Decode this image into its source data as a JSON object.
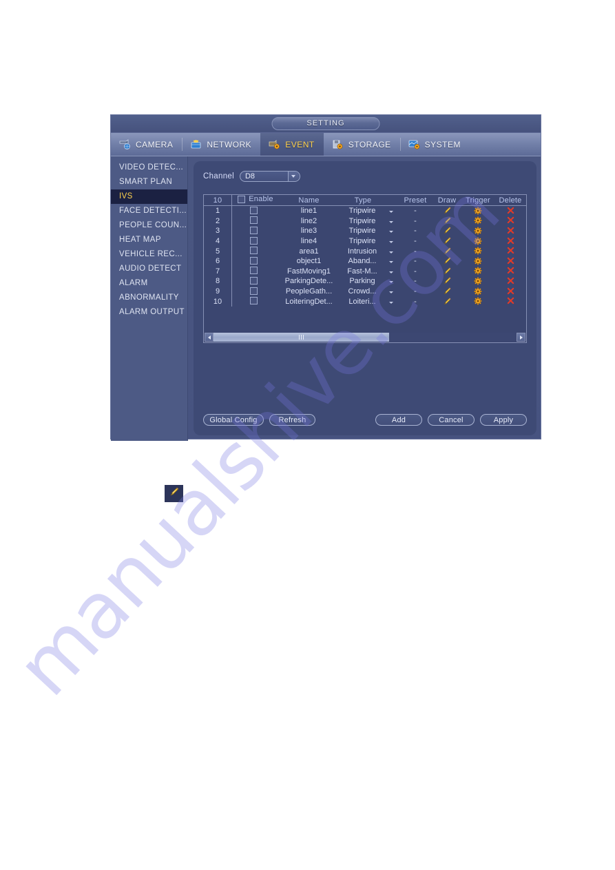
{
  "window": {
    "title": "SETTING"
  },
  "tabs": [
    {
      "label": "CAMERA",
      "icon": "camera-icon",
      "active": false
    },
    {
      "label": "NETWORK",
      "icon": "network-icon",
      "active": false
    },
    {
      "label": "EVENT",
      "icon": "event-icon",
      "active": true
    },
    {
      "label": "STORAGE",
      "icon": "storage-icon",
      "active": false
    },
    {
      "label": "SYSTEM",
      "icon": "system-icon",
      "active": false
    }
  ],
  "sidebar": {
    "items": [
      {
        "label": "VIDEO DETEC...",
        "active": false
      },
      {
        "label": "SMART PLAN",
        "active": false
      },
      {
        "label": "IVS",
        "active": true
      },
      {
        "label": "FACE DETECTI...",
        "active": false
      },
      {
        "label": "PEOPLE COUN...",
        "active": false
      },
      {
        "label": "HEAT MAP",
        "active": false
      },
      {
        "label": "VEHICLE REC...",
        "active": false
      },
      {
        "label": "AUDIO DETECT",
        "active": false
      },
      {
        "label": "ALARM",
        "active": false
      },
      {
        "label": "ABNORMALITY",
        "active": false
      },
      {
        "label": "ALARM OUTPUT",
        "active": false
      }
    ]
  },
  "channel": {
    "label": "Channel",
    "value": "D8"
  },
  "table": {
    "headers": {
      "count": "10",
      "enable": "Enable",
      "name": "Name",
      "type": "Type",
      "preset": "Preset",
      "draw": "Draw",
      "trigger": "Trigger",
      "delete": "Delete"
    },
    "rows": [
      {
        "no": "1",
        "enabled": false,
        "name": "line1",
        "type": "Tripwire",
        "preset": "-"
      },
      {
        "no": "2",
        "enabled": false,
        "name": "line2",
        "type": "Tripwire",
        "preset": "-"
      },
      {
        "no": "3",
        "enabled": false,
        "name": "line3",
        "type": "Tripwire",
        "preset": "-"
      },
      {
        "no": "4",
        "enabled": false,
        "name": "line4",
        "type": "Tripwire",
        "preset": "-"
      },
      {
        "no": "5",
        "enabled": false,
        "name": "area1",
        "type": "Intrusion",
        "preset": "-"
      },
      {
        "no": "6",
        "enabled": false,
        "name": "object1",
        "type": "Aband...",
        "preset": "-"
      },
      {
        "no": "7",
        "enabled": false,
        "name": "FastMoving1",
        "type": "Fast-M...",
        "preset": "-"
      },
      {
        "no": "8",
        "enabled": false,
        "name": "ParkingDete...",
        "type": "Parking",
        "preset": "-"
      },
      {
        "no": "9",
        "enabled": false,
        "name": "PeopleGath...",
        "type": "Crowd...",
        "preset": "-"
      },
      {
        "no": "10",
        "enabled": false,
        "name": "LoiteringDet...",
        "type": "Loiteri...",
        "preset": "-"
      }
    ],
    "scrollbar": {
      "thumb_percent": "58"
    }
  },
  "footer": {
    "global_config": "Global Config",
    "refresh": "Refresh",
    "add": "Add",
    "cancel": "Cancel",
    "apply": "Apply"
  },
  "figure": {
    "icon": "pencil-icon"
  },
  "watermark": {
    "text": "manualshive.com"
  },
  "colors": {
    "accent_yellow": "#ffd24d",
    "panel_bg": "#3e4a75",
    "window_bg": "#475380",
    "sidebar_bg": "#4d5a85",
    "active_item_bg": "#1b2142",
    "delete_red": "#e03b28",
    "gear_orange": "#f5a623"
  }
}
